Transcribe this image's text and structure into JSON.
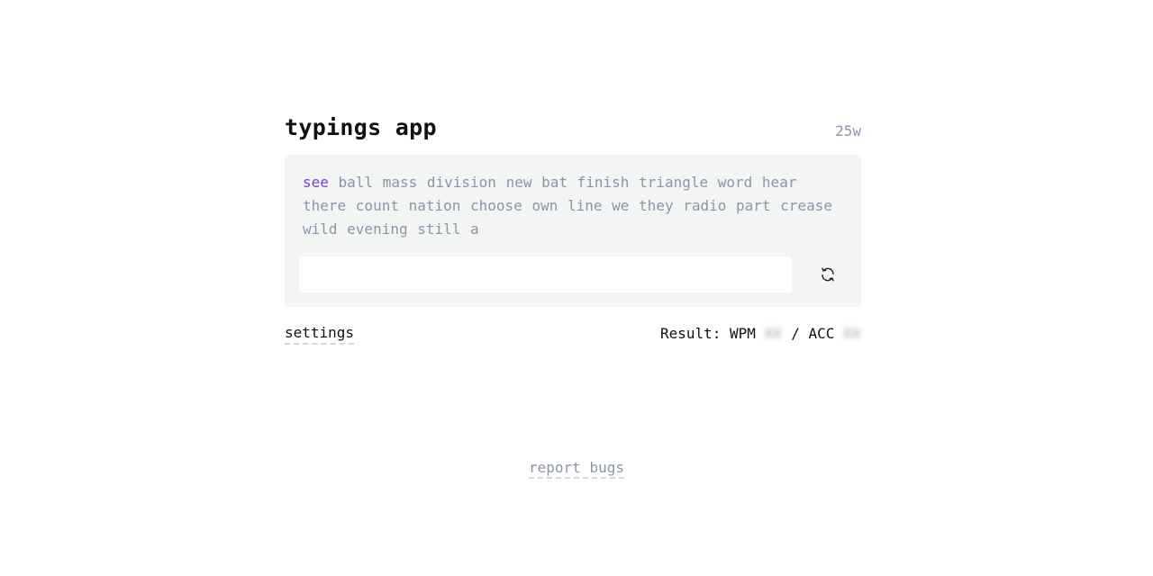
{
  "header": {
    "title": "typings app",
    "word_count": "25w"
  },
  "words": {
    "current": "see",
    "rest": "ball mass division new bat finish triangle word hear there count nation choose own line we they radio part crease wild evening still a"
  },
  "input": {
    "value": "",
    "placeholder": ""
  },
  "reset": {
    "icon": "refresh-icon"
  },
  "settings": {
    "label": "settings"
  },
  "result": {
    "prefix": "Result: WPM",
    "wpm": "XX",
    "separator": "/ ACC",
    "acc": "XX"
  },
  "footer": {
    "report_label": "report bugs"
  },
  "colors": {
    "accent": "#7b3fd6",
    "muted_text": "#8a96a8",
    "box_bg": "#f3f4f4"
  }
}
